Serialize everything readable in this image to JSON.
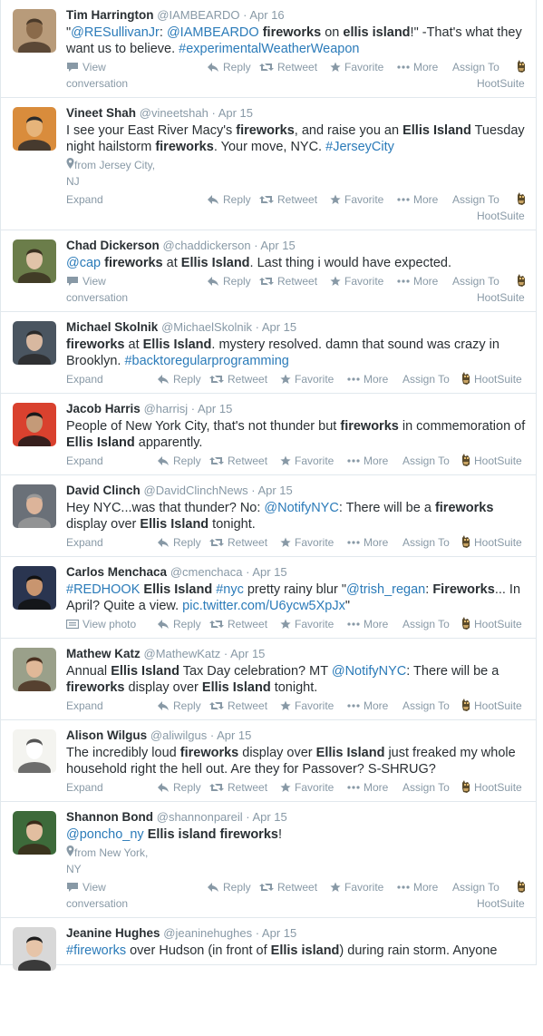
{
  "action_labels": {
    "reply": "Reply",
    "retweet": "Retweet",
    "favorite": "Favorite",
    "more": "More",
    "assign_to": "Assign To",
    "hootsuite": "HootSuite",
    "expand": "Expand",
    "view": "View",
    "conversation": "conversation",
    "view_photo": "View photo"
  },
  "colors": {
    "link": "#2b7bb9",
    "muted": "#8899a6",
    "text": "#292f33",
    "border": "#e1e8ed"
  },
  "tweets": [
    {
      "name": "Tim Harrington",
      "handle": "@IAMBEARDO",
      "time": "Apr 16",
      "avatar": "bearded-man-avatar",
      "parts": [
        {
          "t": "\"",
          "s": ""
        },
        {
          "t": "@RESullivanJr",
          "s": "link"
        },
        {
          "t": ": ",
          "s": ""
        },
        {
          "t": "@IAMBEARDO",
          "s": "link"
        },
        {
          "t": " ",
          "s": ""
        },
        {
          "t": "fireworks",
          "s": "bold"
        },
        {
          "t": " on ",
          "s": ""
        },
        {
          "t": "ellis island",
          "s": "bold"
        },
        {
          "t": "!\" -That's what they want us to believe. ",
          "s": ""
        },
        {
          "t": "#experimentalWeatherWeapon",
          "s": "link"
        }
      ],
      "location": "",
      "footer": "conversation"
    },
    {
      "name": "Vineet Shah",
      "handle": "@vineetshah",
      "time": "Apr 15",
      "avatar": "man-orange-avatar",
      "parts": [
        {
          "t": "I see your East River Macy's ",
          "s": ""
        },
        {
          "t": "fireworks",
          "s": "bold"
        },
        {
          "t": ", and raise you an ",
          "s": ""
        },
        {
          "t": "Ellis Island",
          "s": "bold"
        },
        {
          "t": " Tuesday night hailstorm ",
          "s": ""
        },
        {
          "t": "fireworks",
          "s": "bold"
        },
        {
          "t": ". Your move, NYC. ",
          "s": ""
        },
        {
          "t": "#JerseyCity",
          "s": "link"
        }
      ],
      "location": [
        "from Jersey City,",
        "NJ"
      ],
      "footer": "expand"
    },
    {
      "name": "Chad Dickerson",
      "handle": "@chaddickerson",
      "time": "Apr 15",
      "avatar": "man-green-avatar",
      "parts": [
        {
          "t": "@cap",
          "s": "link"
        },
        {
          "t": " ",
          "s": ""
        },
        {
          "t": "fireworks",
          "s": "bold"
        },
        {
          "t": " at ",
          "s": ""
        },
        {
          "t": "Ellis Island",
          "s": "bold"
        },
        {
          "t": ". Last thing i would have expected.",
          "s": ""
        }
      ],
      "location": "",
      "footer": "conversation"
    },
    {
      "name": "Michael Skolnik",
      "handle": "@MichaelSkolnik",
      "time": "Apr 15",
      "avatar": "man-dark-avatar",
      "parts": [
        {
          "t": "fireworks",
          "s": "bold"
        },
        {
          "t": " at ",
          "s": ""
        },
        {
          "t": "Ellis Island",
          "s": "bold"
        },
        {
          "t": ".  mystery resolved.  damn that sound was crazy in Brooklyn. ",
          "s": ""
        },
        {
          "t": "#backtoregularprogramming",
          "s": "link"
        }
      ],
      "location": "",
      "footer": "expand"
    },
    {
      "name": "Jacob Harris",
      "handle": "@harrisj",
      "time": "Apr 15",
      "avatar": "man-red-avatar",
      "parts": [
        {
          "t": "People of New York City, that's not thunder but ",
          "s": ""
        },
        {
          "t": "fireworks",
          "s": "bold"
        },
        {
          "t": " in commemoration of ",
          "s": ""
        },
        {
          "t": "Ellis Island",
          "s": "bold"
        },
        {
          "t": " apparently.",
          "s": ""
        }
      ],
      "location": "",
      "footer": "expand"
    },
    {
      "name": "David Clinch",
      "handle": "@DavidClinchNews",
      "time": "Apr 15",
      "avatar": "man-glasses-avatar",
      "parts": [
        {
          "t": "Hey NYC...was that thunder? No: ",
          "s": ""
        },
        {
          "t": "@NotifyNYC",
          "s": "link"
        },
        {
          "t": ": There will be a ",
          "s": ""
        },
        {
          "t": "fireworks",
          "s": "bold"
        },
        {
          "t": " display over ",
          "s": ""
        },
        {
          "t": "Ellis Island",
          "s": "bold"
        },
        {
          "t": " tonight.",
          "s": ""
        }
      ],
      "location": "",
      "footer": "expand"
    },
    {
      "name": "Carlos Menchaca",
      "handle": "@cmenchaca",
      "time": "Apr 15",
      "avatar": "man-suit-avatar",
      "parts": [
        {
          "t": "#REDHOOK",
          "s": "link"
        },
        {
          "t": " ",
          "s": ""
        },
        {
          "t": "Ellis Island",
          "s": "bold"
        },
        {
          "t": " ",
          "s": ""
        },
        {
          "t": "#nyc",
          "s": "link"
        },
        {
          "t": " pretty rainy blur \"",
          "s": ""
        },
        {
          "t": "@trish_regan",
          "s": "link"
        },
        {
          "t": ": ",
          "s": ""
        },
        {
          "t": "Fireworks",
          "s": "bold"
        },
        {
          "t": "... In April?  Quite a view. ",
          "s": ""
        },
        {
          "t": "pic.twitter.com/U6ycw5XpJx",
          "s": "link"
        },
        {
          "t": "\"",
          "s": ""
        }
      ],
      "location": "",
      "footer": "photo"
    },
    {
      "name": "Mathew Katz",
      "handle": "@MathewKatz",
      "time": "Apr 15",
      "avatar": "man-curly-avatar",
      "parts": [
        {
          "t": "Annual ",
          "s": ""
        },
        {
          "t": "Ellis Island",
          "s": "bold"
        },
        {
          "t": " Tax Day celebration? MT ",
          "s": ""
        },
        {
          "t": "@NotifyNYC",
          "s": "link"
        },
        {
          "t": ": There will be a ",
          "s": ""
        },
        {
          "t": "fireworks",
          "s": "bold"
        },
        {
          "t": " display over ",
          "s": ""
        },
        {
          "t": "Ellis Island",
          "s": "bold"
        },
        {
          "t": " tonight.",
          "s": ""
        }
      ],
      "location": "",
      "footer": "expand"
    },
    {
      "name": "Alison Wilgus",
      "handle": "@aliwilgus",
      "time": "Apr 15",
      "avatar": "sketch-avatar",
      "parts": [
        {
          "t": "The incredibly loud ",
          "s": ""
        },
        {
          "t": "fireworks",
          "s": "bold"
        },
        {
          "t": " display over ",
          "s": ""
        },
        {
          "t": "Ellis Island",
          "s": "bold"
        },
        {
          "t": " just freaked my whole household right the hell out. Are they for Passover? S-SHRUG?",
          "s": ""
        }
      ],
      "location": "",
      "footer": "expand"
    },
    {
      "name": "Shannon Bond",
      "handle": "@shannonpareil",
      "time": "Apr 15",
      "avatar": "woman-plants-avatar",
      "parts": [
        {
          "t": "@poncho_ny",
          "s": "link"
        },
        {
          "t": " ",
          "s": ""
        },
        {
          "t": "Ellis island fireworks",
          "s": "bold"
        },
        {
          "t": "!",
          "s": ""
        }
      ],
      "location": [
        "from New York,",
        "NY"
      ],
      "footer": "conversation"
    },
    {
      "name": "Jeanine Hughes",
      "handle": "@jeaninehughes",
      "time": "Apr 15",
      "avatar": "woman-curly-avatar",
      "parts": [
        {
          "t": "#fireworks",
          "s": "link"
        },
        {
          "t": " over Hudson (in front of ",
          "s": ""
        },
        {
          "t": "Ellis island",
          "s": "bold"
        },
        {
          "t": ") during rain storm. Anyone",
          "s": ""
        }
      ],
      "location": "",
      "footer": "none"
    }
  ]
}
